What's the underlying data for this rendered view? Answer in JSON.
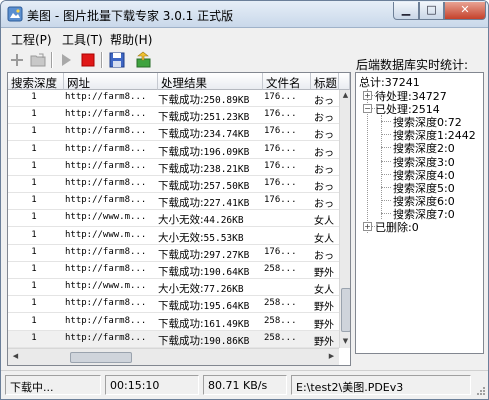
{
  "window": {
    "title": "美图 - 图片批量下载专家 3.0.1 正式版"
  },
  "menu": {
    "items": [
      "工程(P)",
      "工具(T)",
      "帮助(H)"
    ]
  },
  "toolbar": {
    "icons": [
      "add-icon",
      "open-folder-icon",
      "play-icon",
      "stop-icon",
      "save-icon",
      "export-icon"
    ]
  },
  "grid": {
    "columns": [
      "搜索深度",
      "网址",
      "处理结果",
      "文件名",
      "标题"
    ],
    "rows": [
      {
        "depth": "1",
        "url": "http://farm8...",
        "status": "下载成功:",
        "size": "250.89KB",
        "file": "176...",
        "title": "おっ"
      },
      {
        "depth": "1",
        "url": "http://farm8...",
        "status": "下载成功:",
        "size": "251.23KB",
        "file": "176...",
        "title": "おっ"
      },
      {
        "depth": "1",
        "url": "http://farm8...",
        "status": "下载成功:",
        "size": "234.74KB",
        "file": "176...",
        "title": "おっ"
      },
      {
        "depth": "1",
        "url": "http://farm8...",
        "status": "下载成功:",
        "size": "196.09KB",
        "file": "176...",
        "title": "おっ"
      },
      {
        "depth": "1",
        "url": "http://farm8...",
        "status": "下载成功:",
        "size": "238.21KB",
        "file": "176...",
        "title": "おっ"
      },
      {
        "depth": "1",
        "url": "http://farm8...",
        "status": "下载成功:",
        "size": "257.50KB",
        "file": "176...",
        "title": "おっ"
      },
      {
        "depth": "1",
        "url": "http://farm8...",
        "status": "下载成功:",
        "size": "227.41KB",
        "file": "176...",
        "title": "おっ"
      },
      {
        "depth": "1",
        "url": "http://www.m...",
        "status": "大小无效:",
        "size": "44.26KB",
        "file": "",
        "title": "女人"
      },
      {
        "depth": "1",
        "url": "http://www.m...",
        "status": "大小无效:",
        "size": "55.53KB",
        "file": "",
        "title": "女人"
      },
      {
        "depth": "1",
        "url": "http://farm8...",
        "status": "下载成功:",
        "size": "297.27KB",
        "file": "176...",
        "title": "おっ"
      },
      {
        "depth": "1",
        "url": "http://farm8...",
        "status": "下载成功:",
        "size": "190.64KB",
        "file": "258...",
        "title": "野外"
      },
      {
        "depth": "1",
        "url": "http://www.m...",
        "status": "大小无效:",
        "size": "77.26KB",
        "file": "",
        "title": "女人"
      },
      {
        "depth": "1",
        "url": "http://farm8...",
        "status": "下载成功:",
        "size": "195.64KB",
        "file": "258...",
        "title": "野外"
      },
      {
        "depth": "1",
        "url": "http://farm8...",
        "status": "下载成功:",
        "size": "161.49KB",
        "file": "258...",
        "title": "野外"
      },
      {
        "depth": "1",
        "url": "http://farm8...",
        "status": "下载成功:",
        "size": "190.86KB",
        "file": "258...",
        "title": "野外"
      }
    ]
  },
  "stats": {
    "label": "后端数据库实时统计:",
    "total": "总计:37241",
    "pending": "待处理:34727",
    "processed": "已处理:2514",
    "depths": [
      "搜索深度0:72",
      "搜索深度1:2442",
      "搜索深度2:0",
      "搜索深度3:0",
      "搜索深度4:0",
      "搜索深度5:0",
      "搜索深度6:0",
      "搜索深度7:0"
    ],
    "deleted": "已删除:0"
  },
  "status": {
    "state": "下载中...",
    "elapsed": "00:15:10",
    "speed": "80.71 KB/s",
    "path": "E:\\test2\\美图.PDEv3"
  }
}
